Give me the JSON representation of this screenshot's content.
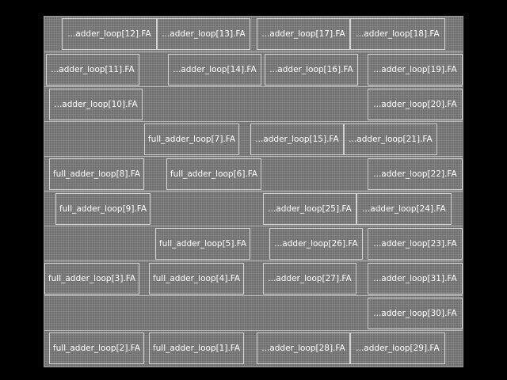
{
  "layout_view": {
    "cells": [
      {
        "label": "...adder_loop[12].FA"
      },
      {
        "label": "...adder_loop[13].FA"
      },
      {
        "label": "...adder_loop[17].FA"
      },
      {
        "label": "...adder_loop[18].FA"
      },
      {
        "label": "...adder_loop[11].FA"
      },
      {
        "label": "...adder_loop[14].FA"
      },
      {
        "label": "...adder_loop[16].FA"
      },
      {
        "label": "...adder_loop[19].FA"
      },
      {
        "label": "...adder_loop[10].FA"
      },
      {
        "label": "...adder_loop[20].FA"
      },
      {
        "label": "full_adder_loop[7].FA"
      },
      {
        "label": "...adder_loop[15].FA"
      },
      {
        "label": "...adder_loop[21].FA"
      },
      {
        "label": "full_adder_loop[8].FA"
      },
      {
        "label": "full_adder_loop[6].FA"
      },
      {
        "label": "...adder_loop[22].FA"
      },
      {
        "label": "full_adder_loop[9].FA"
      },
      {
        "label": "...adder_loop[25].FA"
      },
      {
        "label": "...adder_loop[24].FA"
      },
      {
        "label": "full_adder_loop[5].FA"
      },
      {
        "label": "...adder_loop[26].FA"
      },
      {
        "label": "...adder_loop[23].FA"
      },
      {
        "label": "full_adder_loop[3].FA"
      },
      {
        "label": "full_adder_loop[4].FA"
      },
      {
        "label": "...adder_loop[27].FA"
      },
      {
        "label": "...adder_loop[31].FA"
      },
      {
        "label": "...adder_loop[30].FA"
      },
      {
        "label": "full_adder_loop[2].FA"
      },
      {
        "label": "full_adder_loop[1].FA"
      },
      {
        "label": "...adder_loop[28].FA"
      },
      {
        "label": "...adder_loop[29].FA"
      }
    ]
  }
}
